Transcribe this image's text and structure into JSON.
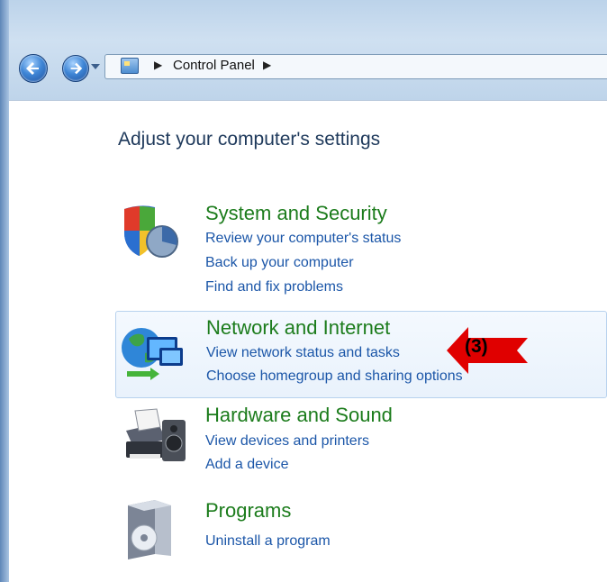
{
  "breadcrumb": {
    "items": [
      "Control Panel"
    ]
  },
  "page": {
    "title": "Adjust your computer's settings"
  },
  "categories": [
    {
      "title": "System and Security",
      "links": [
        "Review your computer's status",
        "Back up your computer",
        "Find and fix problems"
      ]
    },
    {
      "title": "Network and Internet",
      "links": [
        "View network status and tasks",
        "Choose homegroup and sharing options"
      ]
    },
    {
      "title": "Hardware and Sound",
      "links": [
        "View devices and printers",
        "Add a device"
      ]
    },
    {
      "title": "Programs",
      "links": [
        "Uninstall a program"
      ]
    }
  ],
  "annotation": {
    "label": "(3)"
  },
  "colors": {
    "category_title": "#1c7c1c",
    "link": "#1b56a8",
    "highlight_bg": "#eaf3fc",
    "arrow": "#e00000"
  }
}
